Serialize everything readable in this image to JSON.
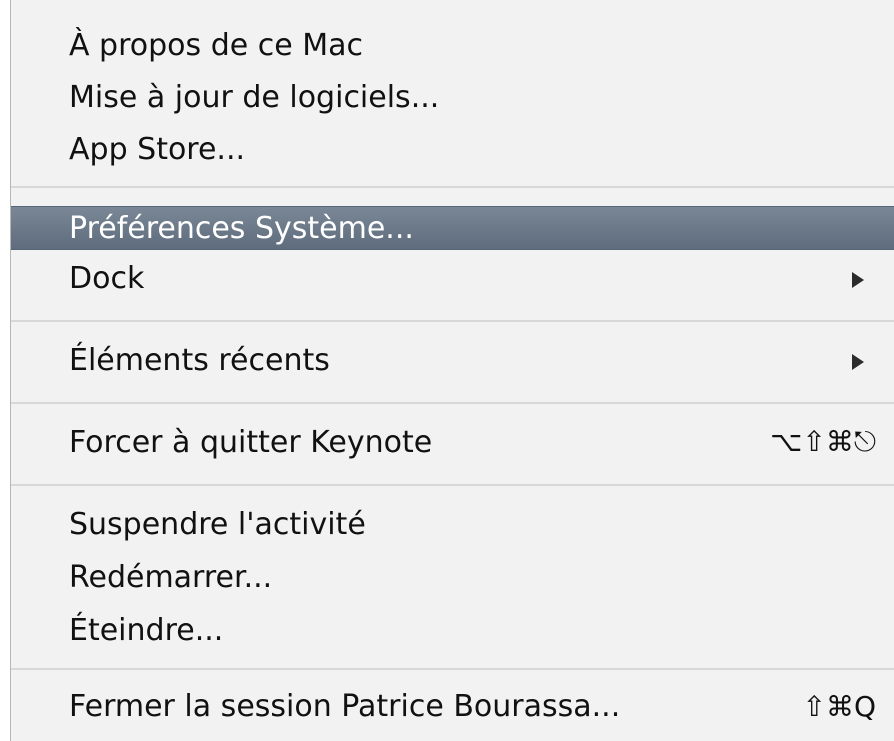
{
  "menu": {
    "items": [
      {
        "label": "À propos de ce Mac"
      },
      {
        "label": "Mise à jour de logiciels..."
      },
      {
        "label": "App Store..."
      },
      {
        "label": "Préférences Système..."
      },
      {
        "label": "Dock",
        "submenu_arrow": "submenu-arrow-icon"
      },
      {
        "label": "Éléments récents",
        "submenu_arrow": "submenu-arrow-icon"
      },
      {
        "label": "Forcer à quitter Keynote",
        "shortcut": "⌥⇧⌘⎋"
      },
      {
        "label": "Suspendre l'activité"
      },
      {
        "label": "Redémarrer..."
      },
      {
        "label": "Éteindre..."
      },
      {
        "label": "Fermer la session Patrice Bourassa...",
        "shortcut": "⇧⌘Q"
      }
    ],
    "highlighted_index": 3,
    "colors": {
      "background": "#f2f2f2",
      "highlight": "#6b7888",
      "separator": "#d8d8d8",
      "text": "#111111"
    }
  }
}
